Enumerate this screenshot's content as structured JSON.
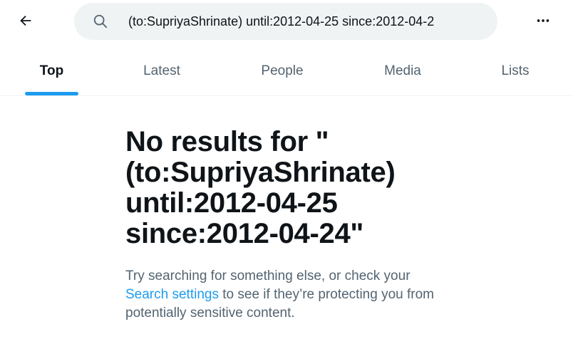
{
  "search": {
    "query": "(to:SupriyaShrinate) until:2012-04-25 since:2012-04-2"
  },
  "icons": {
    "back": "arrow-left-icon",
    "search": "search-icon",
    "more": "more-horizontal-icon"
  },
  "tabs": [
    {
      "label": "Top",
      "active": true
    },
    {
      "label": "Latest",
      "active": false
    },
    {
      "label": "People",
      "active": false
    },
    {
      "label": "Media",
      "active": false
    },
    {
      "label": "Lists",
      "active": false
    }
  ],
  "empty_state": {
    "title_lines": [
      "No results for \"",
      "(to:SupriyaShrinate)",
      "until:2012-04-25",
      "since:2012-04-24\""
    ],
    "desc_before": "Try searching for something else, or check your ",
    "desc_link": "Search settings",
    "desc_after": " to see if they’re protecting you from potentially sensitive content."
  },
  "colors": {
    "accent": "#1d9bf0",
    "text_primary": "#0f1419",
    "text_secondary": "#536471",
    "search_bg": "#eff3f4"
  }
}
